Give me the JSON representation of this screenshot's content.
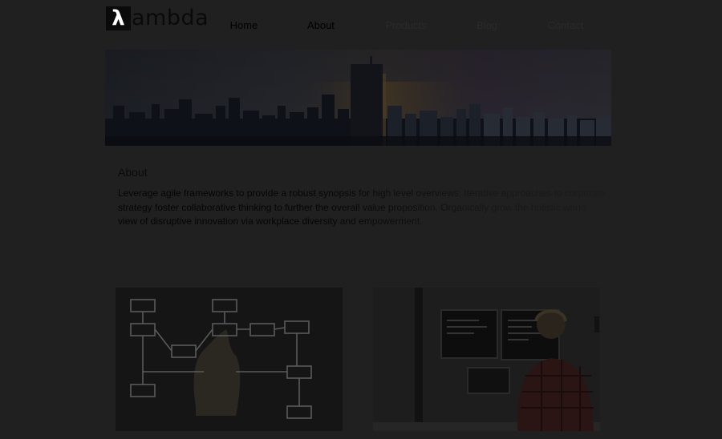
{
  "header": {
    "logo_mark": "λ",
    "logo_text": "ambda",
    "nav": [
      {
        "label": "Home"
      },
      {
        "label": "About"
      },
      {
        "label": "Products"
      },
      {
        "label": "Blog"
      },
      {
        "label": "Contact"
      }
    ]
  },
  "about": {
    "title": "About",
    "text": "Leverage agile frameworks to provide a robust synopsis for high level overviews. Iterative approaches to corporate strategy foster collaborative thinking to further the overall value proposition. Organically grow the holistic world view of disruptive innovation via workplace diversity and empowerment."
  },
  "colors": {
    "background": "#202020",
    "text": "#0a0a0a"
  },
  "images": [
    {
      "icon": "flowchart-whiteboard-image"
    },
    {
      "icon": "developer-at-monitors-image"
    }
  ]
}
